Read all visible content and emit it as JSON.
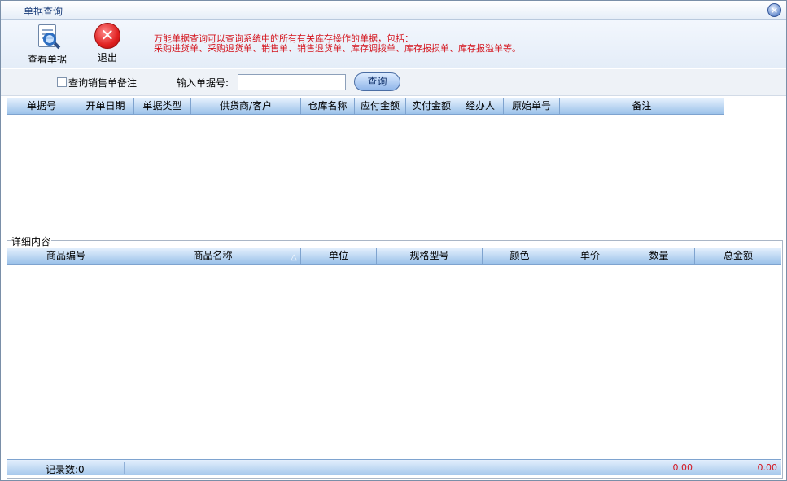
{
  "window": {
    "title": "单据查询",
    "close_icon": "close-icon"
  },
  "toolbar": {
    "view_label": "查看单据",
    "exit_label": "退出",
    "info_line1": "万能单据查询可以查询系统中的所有有关库存操作的单据，包括：",
    "info_line2": "采购进货单、采购退货单、销售单、销售退货单、库存调拨单、库存报损单、库存报溢单等。"
  },
  "search": {
    "checkbox_label": "查询销售单备注",
    "checkbox_checked": false,
    "input_label": "输入单据号:",
    "input_value": "",
    "query_label": "查询"
  },
  "order_grid": {
    "columns": [
      "单据号",
      "开单日期",
      "单据类型",
      "供货商/客户",
      "仓库名称",
      "应付金额",
      "实付金额",
      "经办人",
      "原始单号",
      "备注"
    ]
  },
  "detail": {
    "legend": "详细内容",
    "columns": [
      "商品编号",
      "商品名称",
      "单位",
      "规格型号",
      "颜色",
      "单价",
      "数量",
      "总金额"
    ]
  },
  "status": {
    "record_count": "记录数:0",
    "quantity_total": "0.00",
    "amount_total": "0.00"
  },
  "colors": {
    "accent_red": "#d4141d",
    "header_blue": "#9cc2ea",
    "title_blue": "#1a3d7a"
  }
}
